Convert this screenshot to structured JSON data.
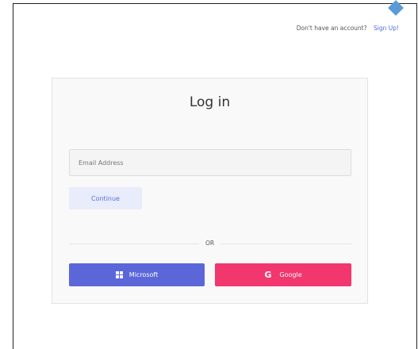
{
  "header": {
    "account_prompt": "Don't have an account?",
    "signup_link": "Sign Up!"
  },
  "login": {
    "title": "Log in",
    "email": {
      "placeholder": "Email Address",
      "value": ""
    },
    "continue_label": "Continue",
    "divider_text": "OR",
    "microsoft_label": "Microsoft",
    "google_label": "Google",
    "google_icon_glyph": "G"
  },
  "icons": {
    "microsoft": "microsoft-icon",
    "google": "google-icon"
  },
  "colors": {
    "accent_link": "#4a6fd6",
    "microsoft_button": "#5b67d9",
    "google_button": "#f2366e",
    "continue_button_bg": "#e8ecfb",
    "continue_button_text": "#5b73d6",
    "card_background": "#f9f9f9"
  }
}
